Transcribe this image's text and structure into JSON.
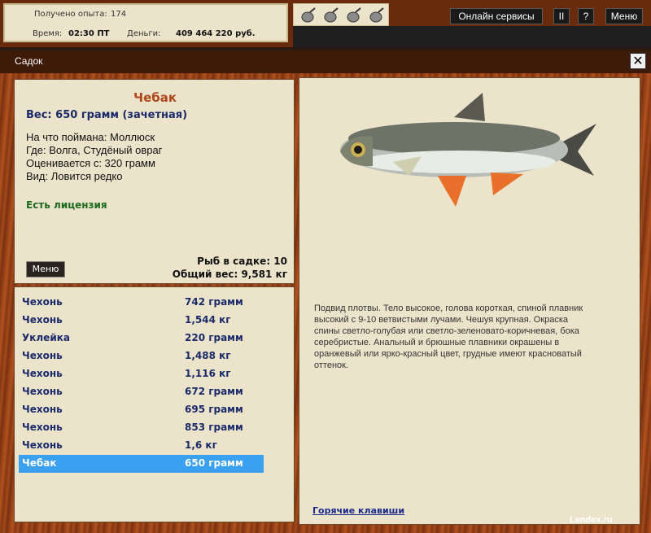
{
  "top": {
    "xp_label": "Получено опыта:",
    "xp_value": "174",
    "time_label": "Время:",
    "time_value": "02:30 ПТ",
    "money_label": "Деньги:",
    "money_value": "409 464 220 руб.",
    "fish_icons": [
      "fish-bag-icon",
      "fish-bag-icon",
      "fish-bag-icon",
      "fish-bag-icon"
    ],
    "online_label": "Онлайн сервисы",
    "pause_label": "II",
    "help_label": "?",
    "menu_label": "Меню"
  },
  "window": {
    "title": "Садок",
    "close_label": "✕"
  },
  "fish": {
    "name": "Чебак",
    "weight": "Вес: 650 грамм (зачетная)",
    "bait": "На что поймана: Моллюск",
    "place": "Где: Волга, Студёный овраг",
    "valued": "Оценивается с: 320 грамм",
    "kind": "Вид: Ловится редко",
    "license": "Есть лицензия",
    "menu_label": "Меню",
    "count": "Рыб в садке: 10",
    "total": "Общий вес: 9,581 кг"
  },
  "catch_list": [
    {
      "name": "Чехонь",
      "weight": "742 грамм"
    },
    {
      "name": "Чехонь",
      "weight": "1,544 кг"
    },
    {
      "name": "Уклейка",
      "weight": "220 грамм"
    },
    {
      "name": "Чехонь",
      "weight": "1,488 кг"
    },
    {
      "name": "Чехонь",
      "weight": "1,116 кг"
    },
    {
      "name": "Чехонь",
      "weight": "672 грамм"
    },
    {
      "name": "Чехонь",
      "weight": "695 грамм"
    },
    {
      "name": "Чехонь",
      "weight": "853 грамм"
    },
    {
      "name": "Чехонь",
      "weight": "1,6 кг"
    },
    {
      "name": "Чебак",
      "weight": "650 грамм"
    }
  ],
  "selected_index": 9,
  "description": "Подвид плотвы. Тело высокое, голова короткая, спиной плавник высокий с 9-10 ветвистыми лучами. Чешуя крупная. Окраска спины светло-голубая или светло-зеленовато-коричневая, бока серебристые. Анальный и брюшные плавники окрашены в оранжевый или ярко-красный цвет, грудные имеют красноватый оттенок.",
  "hotkeys": "Горячие клавиши",
  "watermark": "Lendex.ru",
  "colors": {
    "accent": "#b0481b",
    "selected": "#3aa0f0",
    "list_text": "#1a2a6a",
    "license": "#1e6a1e"
  }
}
